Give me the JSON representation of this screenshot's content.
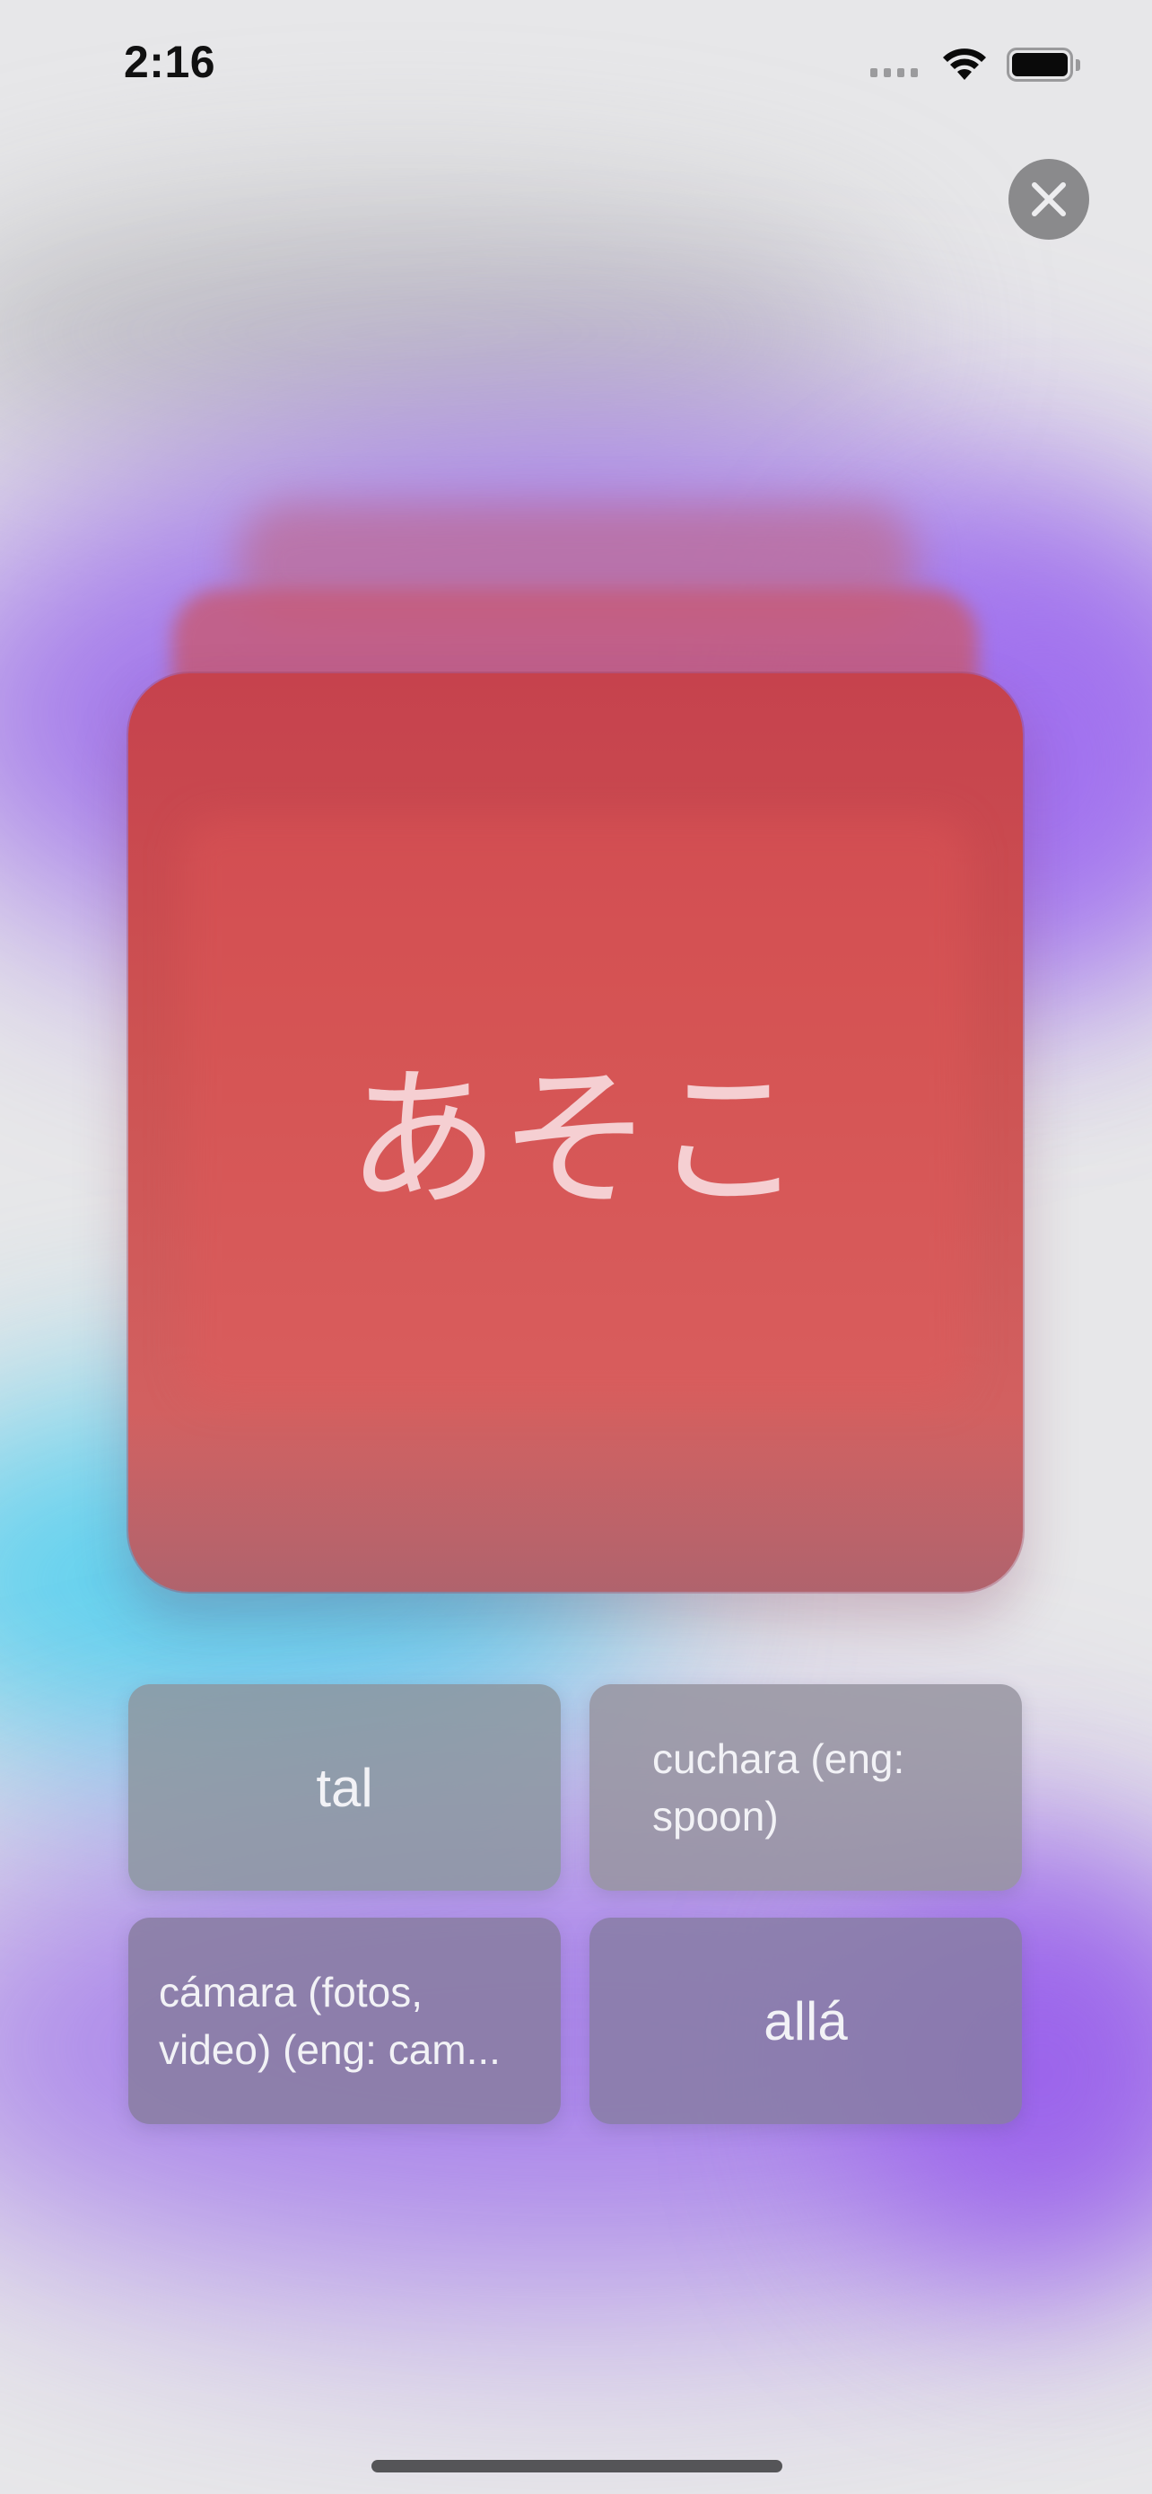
{
  "status_bar": {
    "time": "2:16"
  },
  "close_button": {
    "icon": "close-icon"
  },
  "card": {
    "word": "あそこ",
    "color": "#cd5252"
  },
  "answers": [
    {
      "label": "tal"
    },
    {
      "label": "cuchara (eng: spoon)"
    },
    {
      "label": "cámara (fotos, video) (eng: cam..."
    },
    {
      "label": "allá"
    }
  ],
  "colors": {
    "card_red": "#cd5252",
    "answer_bg": "#8c8c98",
    "accent_purple": "#9664eb",
    "accent_cyan": "#46cdf0"
  }
}
